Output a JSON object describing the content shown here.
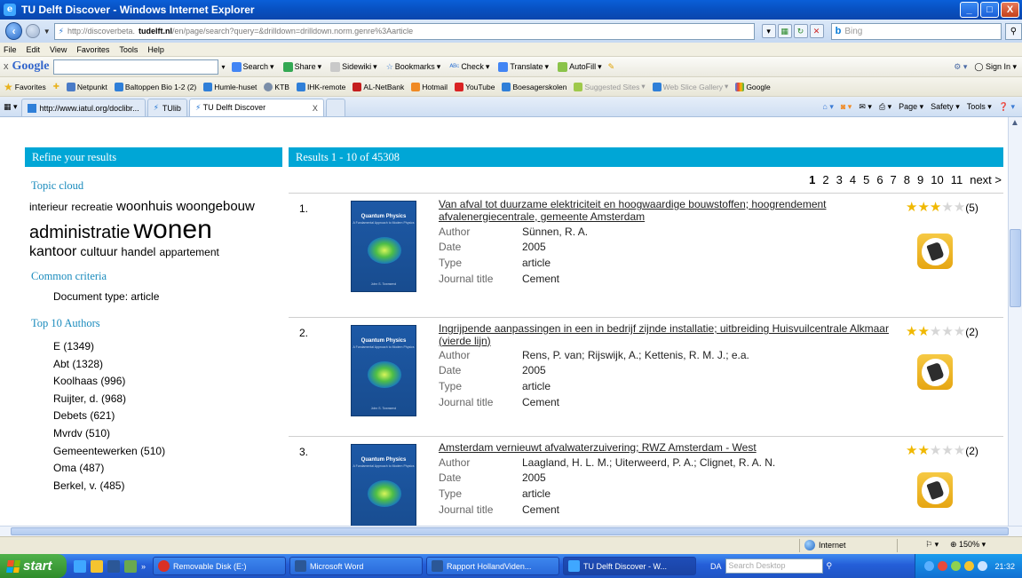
{
  "window": {
    "title": "TU Delft Discover - Windows Internet Explorer",
    "minimize": "_",
    "maximize": "□",
    "close": "X"
  },
  "address_bar": {
    "url_prefix": "http://discoverbeta.",
    "url_domain": "tudelft.nl",
    "url_path": "/en/page/search?query=&drilldown=drilldown.norm.genre%3Aarticle",
    "search_placeholder": "Bing",
    "bing_logo": "b"
  },
  "menu": [
    "File",
    "Edit",
    "View",
    "Favorites",
    "Tools",
    "Help"
  ],
  "google_toolbar": {
    "logo": "Google",
    "close": "x",
    "buttons": [
      "Search",
      "Share",
      "Sidewiki",
      "Bookmarks",
      "Check",
      "Translate",
      "AutoFill"
    ],
    "sign_in": "Sign In"
  },
  "favorites_bar": {
    "label": "Favorites",
    "items": [
      "Netpunkt",
      "Baltoppen Bio 1-2 (2)",
      "Humle-huset",
      "KTB",
      "IHK-remote",
      "AL-NetBank",
      "Hotmail",
      "YouTube",
      "Boesagerskolen",
      "Suggested Sites",
      "Web Slice Gallery",
      "Google"
    ]
  },
  "tabs": {
    "items": [
      "http://www.iatul.org/doclibr...",
      "TUlib",
      "TU Delft Discover"
    ],
    "close": "X",
    "tools": [
      "Page",
      "Safety",
      "Tools"
    ]
  },
  "sidebar": {
    "header": "Refine your results",
    "topic_cloud_title": "Topic cloud",
    "topic_cloud": [
      {
        "word": "interieur",
        "size": 12
      },
      {
        "word": "recreatie",
        "size": 12
      },
      {
        "word": "woonhuis",
        "size": 15
      },
      {
        "word": "woongebouw",
        "size": 15
      },
      {
        "word": "administratie",
        "size": 20
      },
      {
        "word": "wonen",
        "size": 30
      },
      {
        "word": "kantoor",
        "size": 16
      },
      {
        "word": "cultuur",
        "size": 14
      },
      {
        "word": "handel",
        "size": 13
      },
      {
        "word": "appartement",
        "size": 12
      }
    ],
    "common_criteria_title": "Common criteria",
    "common_criteria": "Document type: article",
    "top_authors_title": "Top 10 Authors",
    "authors": [
      "E (1349)",
      "Abt (1328)",
      "Koolhaas (996)",
      "Ruijter, d. (968)",
      "Debets (621)",
      "Mvrdv (510)",
      "Gemeentewerken (510)",
      "Oma (487)",
      "Berkel, v. (485)"
    ]
  },
  "results": {
    "header": "Results 1 - 10 of 45308",
    "pages": [
      "1",
      "2",
      "3",
      "4",
      "5",
      "6",
      "7",
      "8",
      "9",
      "10",
      "11"
    ],
    "current_page": "1",
    "next": "next >",
    "labels": {
      "author": "Author",
      "date": "Date",
      "type": "Type",
      "journal": "Journal title"
    },
    "cover": {
      "title": "Quantum Physics",
      "subtitle": "A Fundamental Approach to Modern Physics",
      "author": "John S. Townsend"
    },
    "items": [
      {
        "num": "1.",
        "title": "Van afval tot duurzame elektriciteit en hoogwaardige bouwstoffen; hoogrendement afvalenergiecentrale, gemeente Amsterdam",
        "author": "Sünnen, R. A.",
        "date": "2005",
        "type": "article",
        "journal": "Cement",
        "stars": 3,
        "reviews": "(5)"
      },
      {
        "num": "2.",
        "title": "Ingrijpende aanpassingen in een in bedrijf zijnde installatie; uitbreiding Huisvuilcentrale Alkmaar (vierde lijn)",
        "author": "Rens, P. van; Rijswijk, A.; Kettenis, R. M. J.; e.a.",
        "date": "2005",
        "type": "article",
        "journal": "Cement",
        "stars": 2,
        "reviews": "(2)"
      },
      {
        "num": "3.",
        "title": "Amsterdam vernieuwt afvalwaterzuivering; RWZ Amsterdam - West",
        "author": "Laagland, H. L. M.; Uiterweerd, P. A.; Clignet, R. A. N.",
        "date": "2005",
        "type": "article",
        "journal": "Cement",
        "stars": 2,
        "reviews": "(2)"
      }
    ]
  },
  "statusbar": {
    "zone": "Internet",
    "zoom": "150%"
  },
  "taskbar": {
    "start": "start",
    "tasks": [
      "Removable Disk (E:)",
      "Microsoft Word",
      "Rapport HollandViden...",
      "TU Delft Discover - W..."
    ],
    "desk_label": "DA",
    "desk_search_placeholder": "Search Desktop",
    "time": "21:32"
  }
}
